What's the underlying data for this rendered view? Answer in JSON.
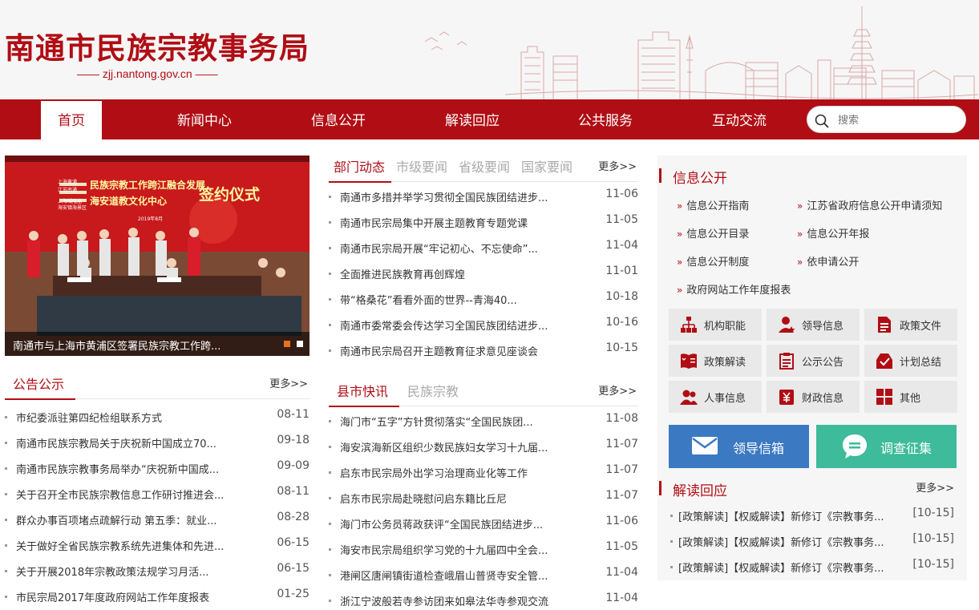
{
  "header": {
    "title": "南通市民族宗教事务局",
    "domain": "—— zjj.nantong.gov.cn ——"
  },
  "nav": {
    "items": [
      "首页",
      "新闻中心",
      "信息公开",
      "解读回应",
      "公共服务",
      "互动交流"
    ],
    "active": "首页",
    "search_placeholder": "搜索"
  },
  "slideshow": {
    "caption": "南通市与上海市黄浦区签署民族宗教工作跨...",
    "banner_main": "民族宗教工作跨江融合发展",
    "banner_sign": "签约仪式",
    "banner_center": "海安道教文化中心",
    "banner_left_top": "上海黄浦",
    "banner_left_mid": "江苏南通",
    "banner_left_bot": "上海城隍庙",
    "banner_left_bot2": "海安镇海景区",
    "banner_date": "2019年8月"
  },
  "notice": {
    "title": "公告公示",
    "more": "更多>>",
    "items": [
      {
        "title": "市纪委派驻第四纪检组联系方式",
        "date": "08-11"
      },
      {
        "title": "南通市民族宗教局关于庆祝新中国成立70...",
        "date": "09-18"
      },
      {
        "title": "南通市民族宗教事务局举办“庆祝新中国成...",
        "date": "09-09"
      },
      {
        "title": "关于召开全市民族宗教信息工作研讨推进会...",
        "date": "08-11"
      },
      {
        "title": "群众办事百项堵点疏解行动 第五季：就业...",
        "date": "08-28"
      },
      {
        "title": "关于做好全省民族宗教系统先进集体和先进...",
        "date": "06-15"
      },
      {
        "title": "关于开展2018年宗教政策法规学习月活...",
        "date": "06-15"
      },
      {
        "title": "市民宗局2017年度政府网站工作年度报表",
        "date": "01-25"
      }
    ]
  },
  "news_top": {
    "tabs": [
      "部门动态",
      "市级要闻",
      "省级要闻",
      "国家要闻"
    ],
    "more": "更多>>",
    "items": [
      {
        "title": "南通市多措并举学习贯彻全国民族团结进步...",
        "date": "11-06"
      },
      {
        "title": "南通市民宗局集中开展主题教育专题党课",
        "date": "11-05"
      },
      {
        "title": "南通市民宗局开展“牢记初心、不忘使命”...",
        "date": "11-04"
      },
      {
        "title": "全面推进民族教育再创辉煌",
        "date": "11-01"
      },
      {
        "title": "带“格桑花”看看外面的世界--青海40...",
        "date": "10-18"
      },
      {
        "title": "南通市委常委会传达学习全国民族团结进步...",
        "date": "10-16"
      },
      {
        "title": "南通市民宗局召开主题教育征求意见座谈会",
        "date": "10-15"
      }
    ]
  },
  "news_bottom": {
    "tabs": [
      "县市快讯",
      "民族宗教"
    ],
    "more": "更多>>",
    "items": [
      {
        "title": "海门市“五字”方针贯彻落实“全国民族团...",
        "date": "11-08"
      },
      {
        "title": "海安滨海新区组织少数民族妇女学习十九届...",
        "date": "11-07"
      },
      {
        "title": "启东市民宗局外出学习治理商业化等工作",
        "date": "11-07"
      },
      {
        "title": "启东市民宗局赴晓慰问启东籍比丘尼",
        "date": "11-07"
      },
      {
        "title": "海门市公务员蒋政获评“全国民族团结进步...",
        "date": "11-06"
      },
      {
        "title": "海安市民宗局组织学习党的十九届四中全会...",
        "date": "11-05"
      },
      {
        "title": "港闸区唐闸镇街道检查峨眉山普贤寺安全管...",
        "date": "11-04"
      },
      {
        "title": "浙江宁波般若寺参访团来如皋法华寺参观交流",
        "date": "11-04"
      }
    ]
  },
  "info_public": {
    "title": "信息公开",
    "links": [
      "信息公开指南",
      "江苏省政府信息公开申请须知",
      "信息公开目录",
      "信息公开年报",
      "信息公开制度",
      "依申请公开",
      "政府网站工作年度报表"
    ],
    "tiles": [
      {
        "label": "机构职能",
        "icon": "org-chart-icon"
      },
      {
        "label": "领导信息",
        "icon": "leader-icon"
      },
      {
        "label": "政策文件",
        "icon": "document-icon"
      },
      {
        "label": "政策解读",
        "icon": "book-icon"
      },
      {
        "label": "公示公告",
        "icon": "notice-board-icon"
      },
      {
        "label": "计划总结",
        "icon": "inbox-check-icon"
      },
      {
        "label": "人事信息",
        "icon": "people-icon"
      },
      {
        "label": "财政信息",
        "icon": "yuan-icon"
      },
      {
        "label": "其他",
        "icon": "grid-icon"
      }
    ],
    "mail_btn": "领导信箱",
    "survey_btn": "调查征集"
  },
  "interpret": {
    "title": "解读回应",
    "more": "更多>>",
    "items": [
      {
        "title": "[政策解读]【权威解读】新修订《宗教事务...",
        "date": "[10-15]"
      },
      {
        "title": "[政策解读]【权威解读】新修订《宗教事务...",
        "date": "[10-15]"
      },
      {
        "title": "[政策解读]【权威解读】新修订《宗教事务...",
        "date": "[10-15]"
      }
    ]
  },
  "colors": {
    "brand": "#b00e14",
    "mail_btn": "#3b79c2",
    "survey_btn": "#3dbb9a"
  }
}
